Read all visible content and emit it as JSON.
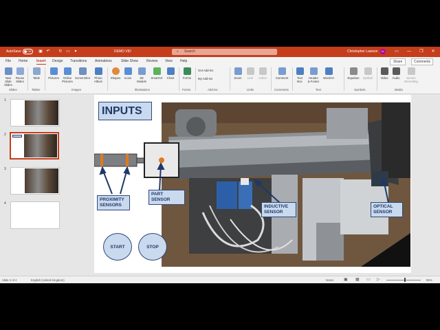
{
  "titlebar": {
    "autosave_label": "AutoSave",
    "autosave_state": "Off",
    "doc_title": "DEMO VID",
    "search_placeholder": "Search",
    "user_name": "Christopher Lawson",
    "user_initials": "CL"
  },
  "tabs": [
    "File",
    "Home",
    "Insert",
    "Design",
    "Transitions",
    "Animations",
    "Slide Show",
    "Review",
    "View",
    "Help"
  ],
  "active_tab": "Insert",
  "share_label": "Share",
  "comments_label": "Comments",
  "ribbon": {
    "buttons": [
      {
        "label": "New Slide",
        "line2": "Slides"
      },
      {
        "label": "Reuse",
        "line2": "Slides"
      },
      {
        "label": "Table",
        "line2": ""
      },
      {
        "label": "Pictures",
        "line2": ""
      },
      {
        "label": "Online",
        "line2": "Pictures"
      },
      {
        "label": "Screenshot",
        "line2": ""
      },
      {
        "label": "Photo",
        "line2": "Album"
      },
      {
        "label": "Shapes",
        "line2": ""
      },
      {
        "label": "Icons",
        "line2": ""
      },
      {
        "label": "3D",
        "line2": "Models"
      },
      {
        "label": "SmartArt",
        "line2": ""
      },
      {
        "label": "Chart",
        "line2": ""
      },
      {
        "label": "Forms",
        "line2": ""
      },
      {
        "label": "Zoom",
        "line2": ""
      },
      {
        "label": "Link",
        "line2": ""
      },
      {
        "label": "Action",
        "line2": ""
      },
      {
        "label": "Comment",
        "line2": ""
      },
      {
        "label": "Text",
        "line2": "Box"
      },
      {
        "label": "Header",
        "line2": "& Footer"
      },
      {
        "label": "WordArt",
        "line2": ""
      },
      {
        "label": "Equation",
        "line2": ""
      },
      {
        "label": "Symbol",
        "line2": ""
      },
      {
        "label": "Video",
        "line2": ""
      },
      {
        "label": "Audio",
        "line2": ""
      },
      {
        "label": "Screen",
        "line2": "Recording"
      }
    ],
    "addins": {
      "get": "Get Add-ins",
      "my": "My Add-ins"
    },
    "groups": [
      "Slides",
      "Tables",
      "Images",
      "Illustrations",
      "Forms",
      "Add-ins",
      "Links",
      "Comments",
      "Text",
      "Symbols",
      "Media"
    ]
  },
  "thumbnails": {
    "numbers": [
      "1",
      "2",
      "3",
      "4"
    ],
    "selected": "2"
  },
  "slide": {
    "title": "INPUTS",
    "callouts": {
      "proximity": "PROXIMITY SENSORS",
      "part": "PART SENSOR",
      "inductive": "INDUCTIVE SENSOR",
      "optical": "OPTICAL SENSOR"
    },
    "buttons": {
      "start": "START",
      "stop": "STOP"
    }
  },
  "statusbar": {
    "slide_info": "Slide 2 of 4",
    "language": "English (United Kingdom)",
    "notes": "Notes",
    "zoom": "85%"
  },
  "colors": {
    "accent": "#c43e1c",
    "callout_fill": "#c9d9ee",
    "callout_border": "#2f4778",
    "callout_text": "#1f3866",
    "arrow": "#1f3866",
    "orange_marker": "#e07a1f"
  }
}
